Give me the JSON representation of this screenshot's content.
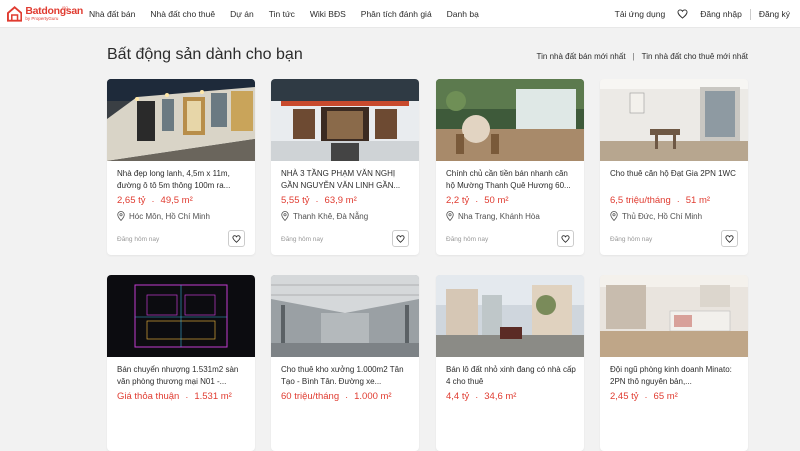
{
  "header": {
    "logo_name": "Batdongsan",
    "logo_sub": "by PropertyGuru",
    "logo_tag": "ISO",
    "nav": [
      "Nhà đất bán",
      "Nhà đất cho thuê",
      "Dự án",
      "Tin tức",
      "Wiki BĐS",
      "Phân tích đánh giá",
      "Danh bạ"
    ],
    "app": "Tải ứng dụng",
    "login": "Đăng nhập",
    "register": "Đăng ký"
  },
  "section": {
    "title": "Bất động sản dành cho bạn",
    "link_sale": "Tin nhà đất bán mới nhất",
    "separator": "|",
    "link_rent": "Tin nhà đất cho thuê mới nhất"
  },
  "listings": [
    {
      "title": "Nhà đẹp long lanh, 4,5m x 11m, đường ô tô 5m thông 100m ra...",
      "price": "2,65 tỷ",
      "area": "49,5 m²",
      "location": "Hóc Môn, Hồ Chí Minh",
      "date": "Đăng hôm nay"
    },
    {
      "title": "NHÀ 3 TẦNG PHẠM VĂN NGHỊ GẦN NGUYỄN VĂN LINH GẦN...",
      "price": "5,55 tỷ",
      "area": "63,9 m²",
      "location": "Thanh Khê, Đà Nẵng",
      "date": "Đăng hôm nay"
    },
    {
      "title": "Chính chủ cần tiền bán nhanh căn hộ Mường Thanh Quê Hương 60...",
      "price": "2,2 tỷ",
      "area": "50 m²",
      "location": "Nha Trang, Khánh Hòa",
      "date": "Đăng hôm nay"
    },
    {
      "title": "Cho thuê căn hộ Đạt Gia 2PN 1WC",
      "price": "6,5 triệu/tháng",
      "area": "51 m²",
      "location": "Thủ Đức, Hồ Chí Minh",
      "date": "Đăng hôm nay"
    },
    {
      "title": "Bán chuyển nhượng 1.531m2 sàn văn phòng thương mại N01 -...",
      "price": "Giá thỏa thuận",
      "area": "1.531 m²"
    },
    {
      "title": "Cho thuê kho xưởng 1.000m2 Tân Tạo - Bình Tân. Đường xe...",
      "price": "60 triệu/tháng",
      "area": "1.000 m²"
    },
    {
      "title": "Bán lô đất nhỏ xinh đang có nhà cấp 4 cho thuê",
      "price": "4,4 tỷ",
      "area": "34,6 m²"
    },
    {
      "title": "Đội ngũ phòng kinh doanh Minato: 2PN thô nguyên bản,...",
      "price": "2,45 tỷ",
      "area": "65 m²"
    }
  ],
  "colors": {
    "brand": "#e03c31",
    "text": "#2c2c2c",
    "background": "#f2f2f2"
  },
  "icons": {
    "favorite": "heart-icon",
    "location": "map-pin-icon"
  }
}
